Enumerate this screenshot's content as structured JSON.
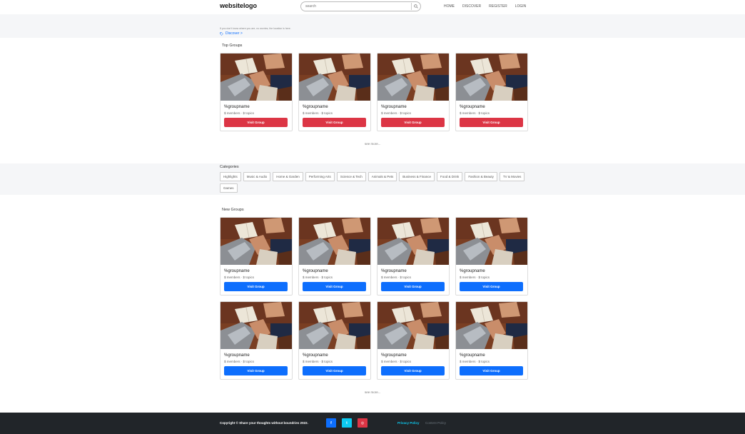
{
  "header": {
    "logo": "websitelogo",
    "search_placeholder": "search",
    "nav": [
      "HOME",
      "DISCOVER",
      "REGISTER",
      "LOGIN"
    ]
  },
  "banner": {
    "text": "If you don't know where you are, no worries, the location is here.",
    "discover_label": "Discover >"
  },
  "top_groups": {
    "title": "Top Groups",
    "see_more": "see more...",
    "cards": [
      {
        "name": "%groupname",
        "meta": "$ members · $ topics",
        "button": "Visit Group"
      },
      {
        "name": "%groupname",
        "meta": "$ members · $ topics",
        "button": "Visit Group"
      },
      {
        "name": "%groupname",
        "meta": "$ members · $ topics",
        "button": "Visit Group"
      },
      {
        "name": "%groupname",
        "meta": "$ members · $ topics",
        "button": "Visit Group"
      }
    ]
  },
  "categories": {
    "title": "Categories",
    "items": [
      "Highlights",
      "Music & Audio",
      "Home & Garden",
      "Performing Arts",
      "Science & Tech",
      "Animals & Pets",
      "Business & Finance",
      "Food & Drink",
      "Fashion & Beauty",
      "TV & Movies",
      "Games"
    ]
  },
  "new_groups": {
    "title": "New Groups",
    "see_more": "see more...",
    "cards": [
      {
        "name": "%groupname",
        "meta": "$ members · $ topics",
        "button": "Visit Group"
      },
      {
        "name": "%groupname",
        "meta": "$ members · $ topics",
        "button": "Visit Group"
      },
      {
        "name": "%groupname",
        "meta": "$ members · $ topics",
        "button": "Visit Group"
      },
      {
        "name": "%groupname",
        "meta": "$ members · $ topics",
        "button": "Visit Group"
      },
      {
        "name": "%groupname",
        "meta": "$ members · $ topics",
        "button": "Visit Group"
      },
      {
        "name": "%groupname",
        "meta": "$ members · $ topics",
        "button": "Visit Group"
      },
      {
        "name": "%groupname",
        "meta": "$ members · $ topics",
        "button": "Visit Group"
      },
      {
        "name": "%groupname",
        "meta": "$ members · $ topics",
        "button": "Visit Group"
      }
    ]
  },
  "footer": {
    "copyright": "Copyright © Share your thoughts without boundries 2022.",
    "social": [
      "facebook-icon",
      "twitter-icon",
      "instagram-icon"
    ],
    "privacy": "Privacy Policy",
    "content_policy": "Content Policy"
  },
  "colors": {
    "top_button": "#dc3545",
    "new_button": "#0d6efd",
    "footer_bg": "#212529",
    "band_bg": "#f5f6f8"
  }
}
